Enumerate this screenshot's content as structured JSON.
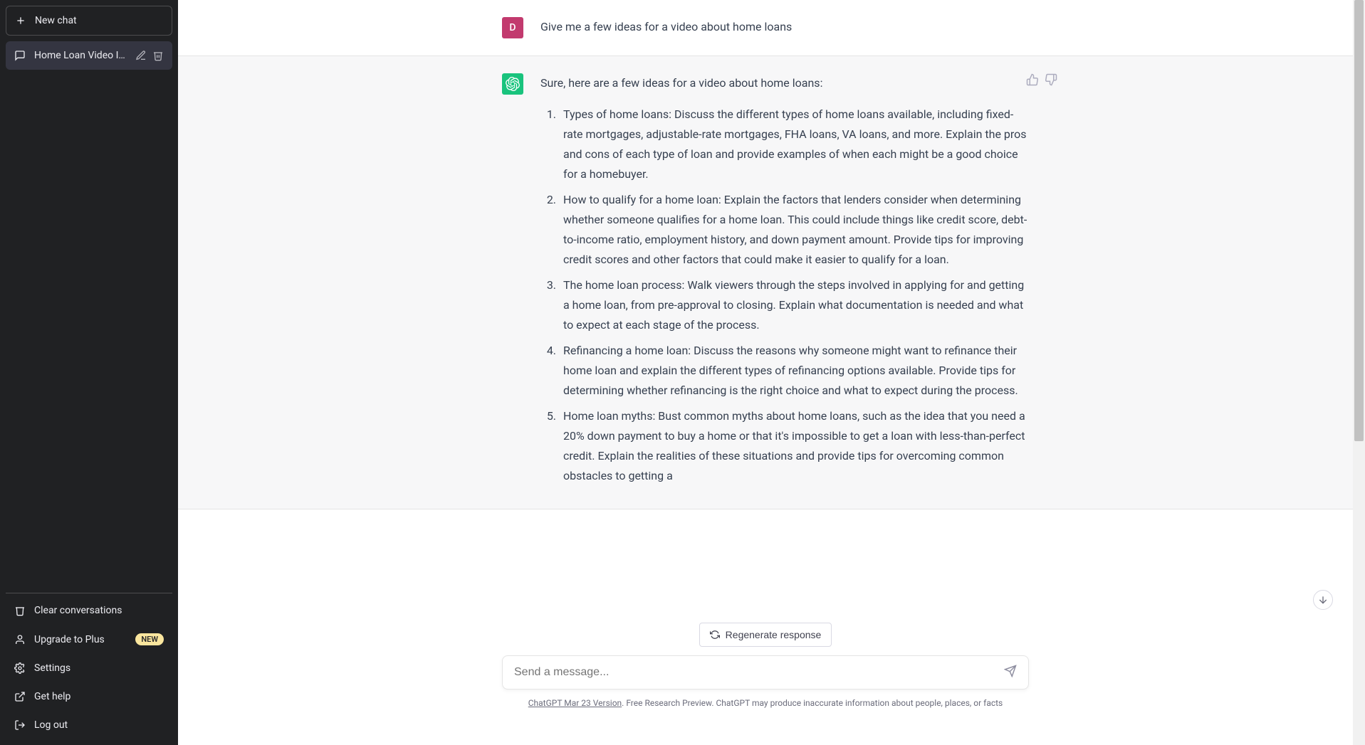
{
  "sidebar": {
    "new_chat_label": "New chat",
    "conversations": [
      {
        "title": "Home Loan Video Idea"
      }
    ],
    "bottom": {
      "clear": "Clear conversations",
      "upgrade": "Upgrade to Plus",
      "upgrade_badge": "NEW",
      "settings": "Settings",
      "help": "Get help",
      "logout": "Log out"
    }
  },
  "chat": {
    "user_avatar_letter": "D",
    "user_message": "Give me a few ideas for a video about home loans",
    "assistant_intro": "Sure, here are a few ideas for a video about home loans:",
    "assistant_list": [
      "Types of home loans: Discuss the different types of home loans available, including fixed-rate mortgages, adjustable-rate mortgages, FHA loans, VA loans, and more. Explain the pros and cons of each type of loan and provide examples of when each might be a good choice for a homebuyer.",
      "How to qualify for a home loan: Explain the factors that lenders consider when determining whether someone qualifies for a home loan. This could include things like credit score, debt-to-income ratio, employment history, and down payment amount. Provide tips for improving credit scores and other factors that could make it easier to qualify for a loan.",
      "The home loan process: Walk viewers through the steps involved in applying for and getting a home loan, from pre-approval to closing. Explain what documentation is needed and what to expect at each stage of the process.",
      "Refinancing a home loan: Discuss the reasons why someone might want to refinance their home loan and explain the different types of refinancing options available. Provide tips for determining whether refinancing is the right choice and what to expect during the process.",
      "Home loan myths: Bust common myths about home loans, such as the idea that you need a 20% down payment to buy a home or that it's impossible to get a loan with less-than-perfect credit. Explain the realities of these situations and provide tips for overcoming common obstacles to getting a"
    ]
  },
  "controls": {
    "regenerate": "Regenerate response",
    "input_placeholder": "Send a message...",
    "footer_version": "ChatGPT Mar 23 Version",
    "footer_rest": ". Free Research Preview. ChatGPT may produce inaccurate information about people, places, or facts"
  }
}
